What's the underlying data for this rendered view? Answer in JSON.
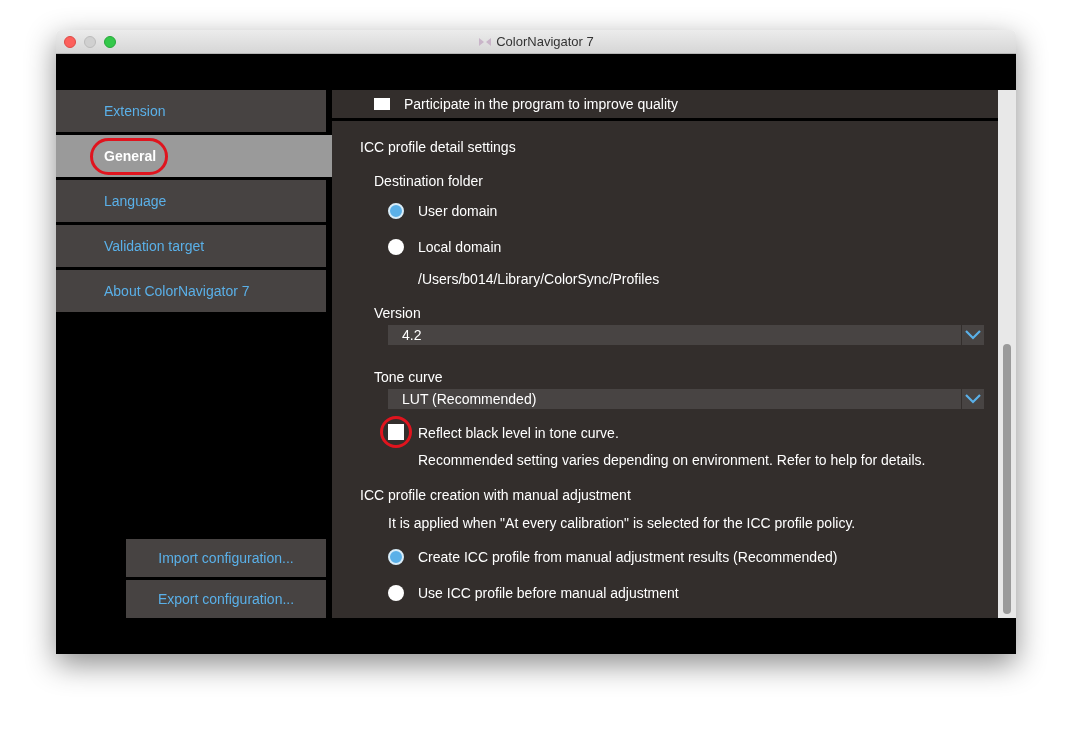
{
  "window": {
    "title": "ColorNavigator 7"
  },
  "sidebar": {
    "items": [
      {
        "label": "Extension",
        "selected": false,
        "annotated": false
      },
      {
        "label": "General",
        "selected": true,
        "annotated": true
      },
      {
        "label": "Language",
        "selected": false,
        "annotated": false
      },
      {
        "label": "Validation target",
        "selected": false,
        "annotated": false
      },
      {
        "label": "About ColorNavigator 7",
        "selected": false,
        "annotated": false
      }
    ],
    "buttons": [
      "Import configuration...",
      "Export configuration..."
    ]
  },
  "top_option": {
    "label": "Participate in the program to improve quality",
    "checked": false
  },
  "icc_settings": {
    "title": "ICC profile detail settings",
    "destination": {
      "label": "Destination folder",
      "options": [
        {
          "label": "User domain",
          "selected": true
        },
        {
          "label": "Local domain",
          "selected": false
        }
      ],
      "path": "/Users/b014/Library/ColorSync/Profiles"
    },
    "version": {
      "label": "Version",
      "value": "4.2"
    },
    "tone_curve": {
      "label": "Tone curve",
      "value": "LUT (Recommended)"
    },
    "reflect_black": {
      "label": "Reflect black level in tone curve.",
      "checked": false,
      "annotated": true,
      "note": "Recommended setting varies depending on environment. Refer to help for details."
    }
  },
  "manual": {
    "title": "ICC profile creation with manual adjustment",
    "note": "It is applied when \"At every calibration\" is selected for the ICC profile policy.",
    "options": [
      {
        "label": "Create ICC profile from manual adjustment results (Recommended)",
        "selected": true
      },
      {
        "label": "Use ICC profile before manual adjustment",
        "selected": false
      }
    ]
  }
}
